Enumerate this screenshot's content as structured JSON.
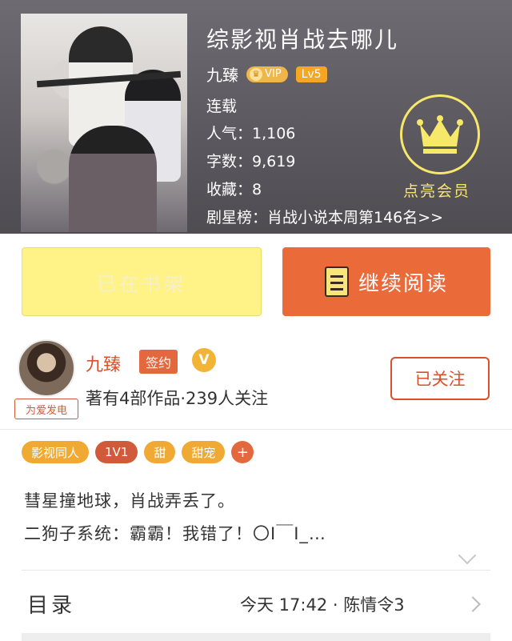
{
  "book": {
    "title": "综影视肖战去哪儿",
    "author": "九臻",
    "vip_badge": "VIP",
    "level_badge": "Lv5",
    "status": "连载",
    "popularity": "人气：1,106",
    "word_count": "字数：9,619",
    "favorites": "收藏：8",
    "ranking": "剧星榜：肖战小说本周第146名>>"
  },
  "vip_member": {
    "label": "点亮会员"
  },
  "actions": {
    "shelf_label": "已在书架",
    "read_label": "继续阅读"
  },
  "author_section": {
    "name": "九臻",
    "signed_badge": "签约",
    "verified_badge": "V",
    "avatar_tag": "为爱发电",
    "stats": "著有4部作品·239人关注",
    "follow_label": "已关注"
  },
  "tags": [
    "影视同人",
    "1V1",
    "甜",
    "甜宠",
    "+"
  ],
  "description": {
    "line1": "彗星撞地球，肖战弄丢了。",
    "line2": "二狗子系统：霸霸！我错了！〇I￣I_…"
  },
  "toc": {
    "label": "目录",
    "latest": "今天 17:42 · 陈情令3"
  },
  "colors": {
    "accent": "#ea6a3a",
    "shelf_button": "#fff287",
    "vip_gold": "#f7e86a"
  },
  "icons": [
    "crown-icon",
    "book-icon",
    "chevron-down-icon",
    "chevron-right-icon"
  ]
}
